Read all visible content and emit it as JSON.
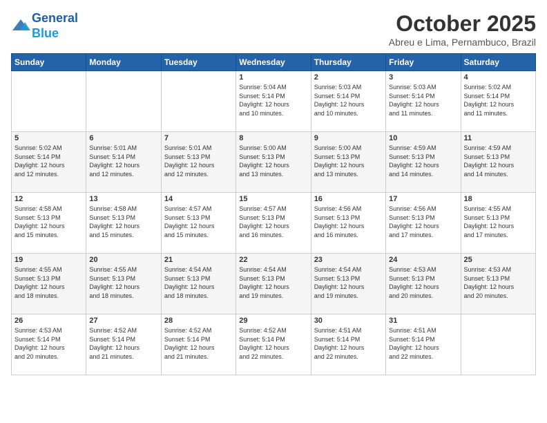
{
  "logo": {
    "line1": "General",
    "line2": "Blue"
  },
  "title": "October 2025",
  "location": "Abreu e Lima, Pernambuco, Brazil",
  "days_of_week": [
    "Sunday",
    "Monday",
    "Tuesday",
    "Wednesday",
    "Thursday",
    "Friday",
    "Saturday"
  ],
  "weeks": [
    [
      {
        "day": "",
        "info": ""
      },
      {
        "day": "",
        "info": ""
      },
      {
        "day": "",
        "info": ""
      },
      {
        "day": "1",
        "info": "Sunrise: 5:04 AM\nSunset: 5:14 PM\nDaylight: 12 hours\nand 10 minutes."
      },
      {
        "day": "2",
        "info": "Sunrise: 5:03 AM\nSunset: 5:14 PM\nDaylight: 12 hours\nand 10 minutes."
      },
      {
        "day": "3",
        "info": "Sunrise: 5:03 AM\nSunset: 5:14 PM\nDaylight: 12 hours\nand 11 minutes."
      },
      {
        "day": "4",
        "info": "Sunrise: 5:02 AM\nSunset: 5:14 PM\nDaylight: 12 hours\nand 11 minutes."
      }
    ],
    [
      {
        "day": "5",
        "info": "Sunrise: 5:02 AM\nSunset: 5:14 PM\nDaylight: 12 hours\nand 12 minutes."
      },
      {
        "day": "6",
        "info": "Sunrise: 5:01 AM\nSunset: 5:14 PM\nDaylight: 12 hours\nand 12 minutes."
      },
      {
        "day": "7",
        "info": "Sunrise: 5:01 AM\nSunset: 5:13 PM\nDaylight: 12 hours\nand 12 minutes."
      },
      {
        "day": "8",
        "info": "Sunrise: 5:00 AM\nSunset: 5:13 PM\nDaylight: 12 hours\nand 13 minutes."
      },
      {
        "day": "9",
        "info": "Sunrise: 5:00 AM\nSunset: 5:13 PM\nDaylight: 12 hours\nand 13 minutes."
      },
      {
        "day": "10",
        "info": "Sunrise: 4:59 AM\nSunset: 5:13 PM\nDaylight: 12 hours\nand 14 minutes."
      },
      {
        "day": "11",
        "info": "Sunrise: 4:59 AM\nSunset: 5:13 PM\nDaylight: 12 hours\nand 14 minutes."
      }
    ],
    [
      {
        "day": "12",
        "info": "Sunrise: 4:58 AM\nSunset: 5:13 PM\nDaylight: 12 hours\nand 15 minutes."
      },
      {
        "day": "13",
        "info": "Sunrise: 4:58 AM\nSunset: 5:13 PM\nDaylight: 12 hours\nand 15 minutes."
      },
      {
        "day": "14",
        "info": "Sunrise: 4:57 AM\nSunset: 5:13 PM\nDaylight: 12 hours\nand 15 minutes."
      },
      {
        "day": "15",
        "info": "Sunrise: 4:57 AM\nSunset: 5:13 PM\nDaylight: 12 hours\nand 16 minutes."
      },
      {
        "day": "16",
        "info": "Sunrise: 4:56 AM\nSunset: 5:13 PM\nDaylight: 12 hours\nand 16 minutes."
      },
      {
        "day": "17",
        "info": "Sunrise: 4:56 AM\nSunset: 5:13 PM\nDaylight: 12 hours\nand 17 minutes."
      },
      {
        "day": "18",
        "info": "Sunrise: 4:55 AM\nSunset: 5:13 PM\nDaylight: 12 hours\nand 17 minutes."
      }
    ],
    [
      {
        "day": "19",
        "info": "Sunrise: 4:55 AM\nSunset: 5:13 PM\nDaylight: 12 hours\nand 18 minutes."
      },
      {
        "day": "20",
        "info": "Sunrise: 4:55 AM\nSunset: 5:13 PM\nDaylight: 12 hours\nand 18 minutes."
      },
      {
        "day": "21",
        "info": "Sunrise: 4:54 AM\nSunset: 5:13 PM\nDaylight: 12 hours\nand 18 minutes."
      },
      {
        "day": "22",
        "info": "Sunrise: 4:54 AM\nSunset: 5:13 PM\nDaylight: 12 hours\nand 19 minutes."
      },
      {
        "day": "23",
        "info": "Sunrise: 4:54 AM\nSunset: 5:13 PM\nDaylight: 12 hours\nand 19 minutes."
      },
      {
        "day": "24",
        "info": "Sunrise: 4:53 AM\nSunset: 5:13 PM\nDaylight: 12 hours\nand 20 minutes."
      },
      {
        "day": "25",
        "info": "Sunrise: 4:53 AM\nSunset: 5:13 PM\nDaylight: 12 hours\nand 20 minutes."
      }
    ],
    [
      {
        "day": "26",
        "info": "Sunrise: 4:53 AM\nSunset: 5:14 PM\nDaylight: 12 hours\nand 20 minutes."
      },
      {
        "day": "27",
        "info": "Sunrise: 4:52 AM\nSunset: 5:14 PM\nDaylight: 12 hours\nand 21 minutes."
      },
      {
        "day": "28",
        "info": "Sunrise: 4:52 AM\nSunset: 5:14 PM\nDaylight: 12 hours\nand 21 minutes."
      },
      {
        "day": "29",
        "info": "Sunrise: 4:52 AM\nSunset: 5:14 PM\nDaylight: 12 hours\nand 22 minutes."
      },
      {
        "day": "30",
        "info": "Sunrise: 4:51 AM\nSunset: 5:14 PM\nDaylight: 12 hours\nand 22 minutes."
      },
      {
        "day": "31",
        "info": "Sunrise: 4:51 AM\nSunset: 5:14 PM\nDaylight: 12 hours\nand 22 minutes."
      },
      {
        "day": "",
        "info": ""
      }
    ]
  ]
}
